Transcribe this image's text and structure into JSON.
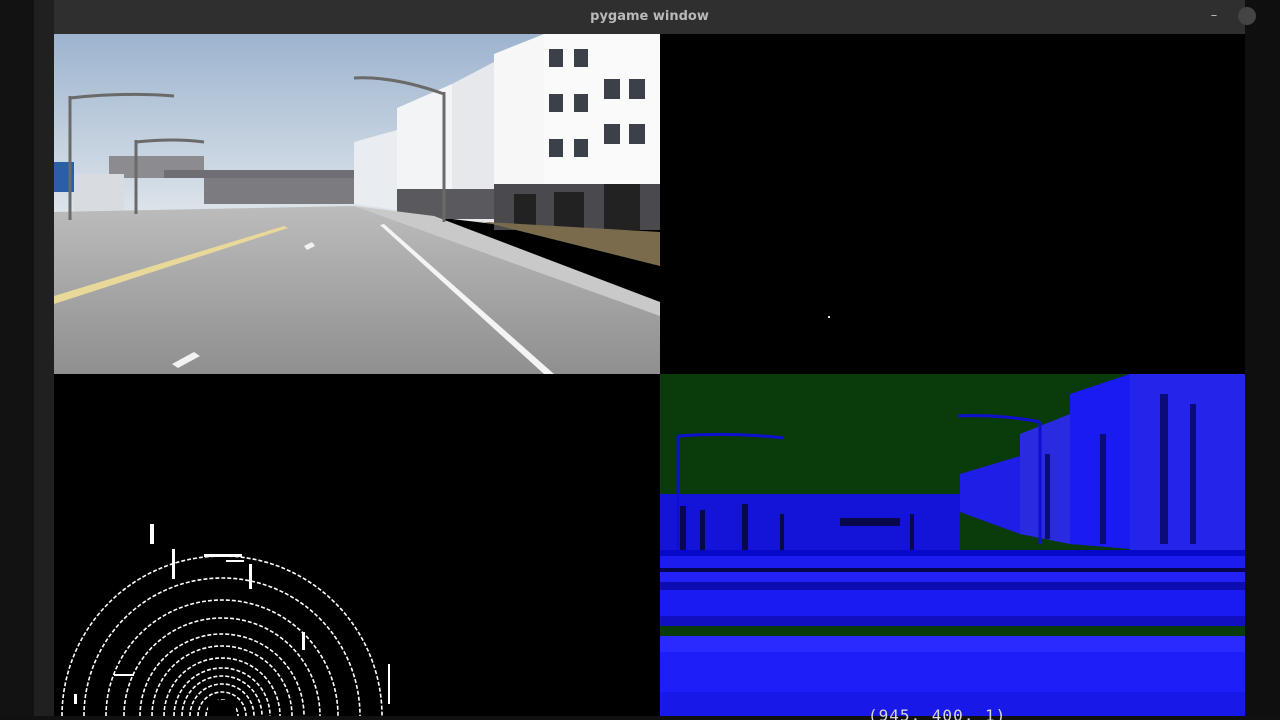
{
  "window": {
    "title": "pygame window",
    "minimize_glyph": "–"
  },
  "panels": [
    {
      "id": "camera-rgb",
      "kind": "RGB camera view"
    },
    {
      "id": "camera-depth",
      "kind": "black camera view"
    },
    {
      "id": "lidar",
      "kind": "lidar point cloud"
    },
    {
      "id": "semantic",
      "kind": "semantic segmentation camera"
    }
  ],
  "overlay": {
    "partial_text": "(945, 400, 1)"
  },
  "colors": {
    "sky": "#c6d3e2",
    "road": "#9b9b9b",
    "semantic_green": "#0a3c0b",
    "semantic_blue": "#1c1cf0",
    "lidar_white": "#ffffff"
  }
}
